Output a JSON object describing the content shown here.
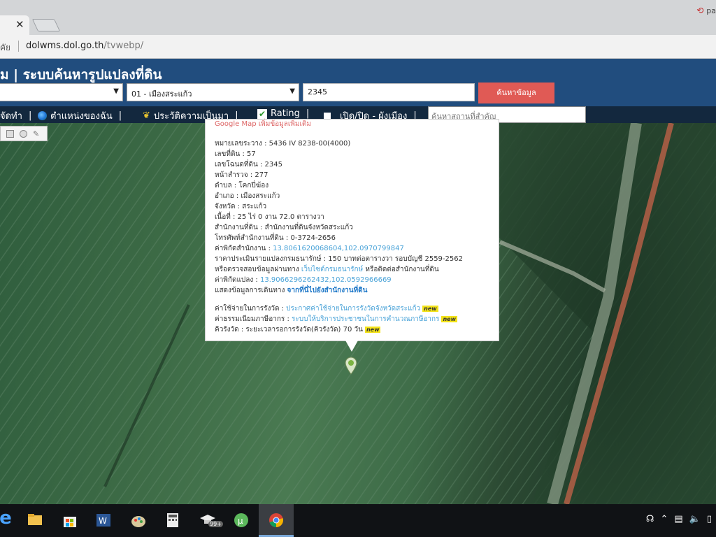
{
  "browser": {
    "tab_close": "✕",
    "url_prefix": "คัย",
    "url_host": "dolwms.dol.go.th",
    "url_path": "/tvwebp/",
    "extension_label": "pa"
  },
  "site": {
    "title": "ม | ระบบค้นหารูปแปลงที่ดิน",
    "province_select": "",
    "district_select": "01 - เมืองสระแก้ว",
    "parcel_input": "2345",
    "search_button": "ค้นหาข้อมูล"
  },
  "toolbar": {
    "item1": "จัดทำ",
    "item2": "ตำแหน่งของฉัน",
    "item3": "ประวัติความเป็นมา",
    "item4": "Rating",
    "item5": "เปิด/ปิด - ผังเมือง",
    "place_search_placeholder": "ค้นหาสถานที่สำคัญ"
  },
  "popup": {
    "top_partial": "Google Map  เพิ่มข้อมูลเพิ่มเติม",
    "sheet_label": "หมายเลขระวาง : ",
    "sheet_value": "5436 IV 8238-00(4000)",
    "land_no_label": "เลขที่ดิน : ",
    "land_no_value": "57",
    "title_deed_label": "เลขโฉนดที่ดิน : ",
    "title_deed_value": "2345",
    "survey_page_label": "หน้าสำรวจ : ",
    "survey_page_value": "277",
    "subdistrict_label": "ตำบล : ",
    "subdistrict_value": "โคกปี่ฆ้อง",
    "district_label": "อำเภอ : ",
    "district_value": "เมืองสระแก้ว",
    "province_label": "จังหวัด : ",
    "province_value": "สระแก้ว",
    "area_label": "เนื้อที่ : ",
    "area_value": "25 ไร่ 0 งาน 72.0 ตารางวา",
    "office_label": "สำนักงานที่ดิน : ",
    "office_value": "สำนักงานที่ดินจังหวัดสระแก้ว",
    "phone_label": "โทรศัพท์สำนักงานที่ดิน : ",
    "phone_value": "0-3724-2656",
    "office_coord_label": "ค่าพิกัดสำนักงาน : ",
    "office_coord_value": "13.8061620068604,102.0970799847",
    "price_label": "ราคาประเมินรายแปลงกรมธนารักษ์ : ",
    "price_value": "150 บาทต่อตารางวา รอบบัญชี 2559-2562",
    "check_label": "หรือตรวจสอบข้อมูลผ่านทาง ",
    "check_link": "เว็บไซต์กรมธนารักษ์",
    "check_suffix": " หรือติดต่อสำนักงานที่ดิน",
    "parcel_coord_label": "ค่าพิกัดแปลง : ",
    "parcel_coord_value": "13.9066296262432,102.0592966669",
    "route_label": "แสดงข้อมูลการเดินทาง ",
    "route_link": "จากที่นี่ไปยังสำนักงานที่ดิน",
    "fee_label": "ค่าใช้จ่ายในการรังวัด : ",
    "fee_link": "ประกาศค่าใช้จ่ายในการรังวัดจังหวัดสระแก้ว",
    "tax_label": "ค่าธรรมเนียมภาษีอากร : ",
    "tax_link": "ระบบให้บริการประชาชนในการคำนวณภาษีอากร",
    "queue_label": "คิวรังวัด : ",
    "queue_value": "ระยะเวลารอการรังวัด(คิวรังวัด) 70 วัน",
    "new_badge": "new"
  },
  "taskbar": {
    "badge": "99+"
  },
  "colors": {
    "header_blue": "#214d7e",
    "toolbar_navy": "#13283e",
    "search_red": "#e05a55",
    "link_blue": "#4aa3d8"
  }
}
